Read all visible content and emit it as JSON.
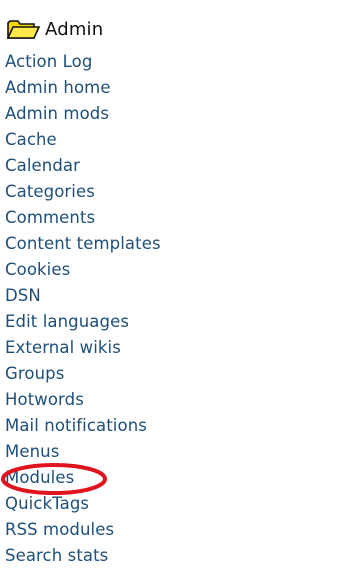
{
  "menu": {
    "title": "Admin",
    "icon": "folder-icon",
    "items": [
      {
        "label": "Action Log"
      },
      {
        "label": "Admin home"
      },
      {
        "label": "Admin mods"
      },
      {
        "label": "Cache"
      },
      {
        "label": "Calendar"
      },
      {
        "label": "Categories"
      },
      {
        "label": "Comments"
      },
      {
        "label": "Content templates"
      },
      {
        "label": "Cookies"
      },
      {
        "label": "DSN"
      },
      {
        "label": "Edit languages"
      },
      {
        "label": "External wikis"
      },
      {
        "label": "Groups"
      },
      {
        "label": "Hotwords"
      },
      {
        "label": "Mail notifications"
      },
      {
        "label": "Menus"
      },
      {
        "label": "Modules"
      },
      {
        "label": "QuickTags"
      },
      {
        "label": "RSS modules"
      },
      {
        "label": "Search stats"
      }
    ]
  },
  "highlight": {
    "target": "Modules",
    "color": "#e0141e"
  },
  "colors": {
    "link": "#1e4f7a",
    "title": "#111111",
    "folder": "#e8c400"
  }
}
